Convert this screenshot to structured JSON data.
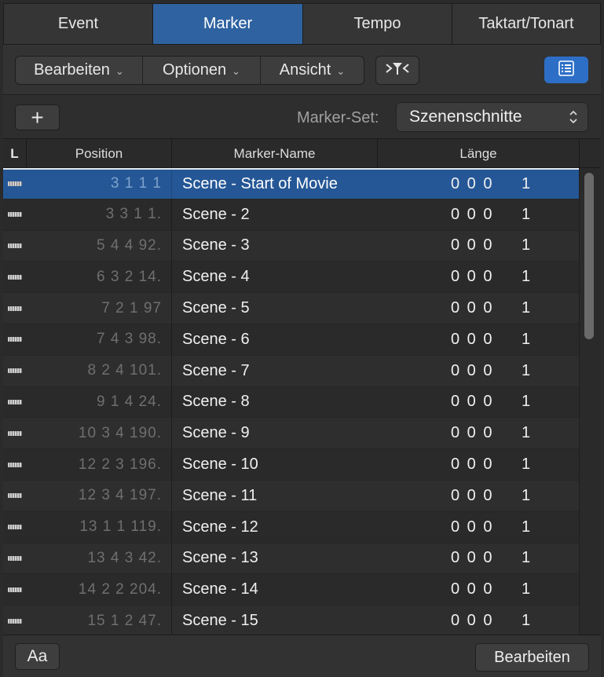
{
  "tabs": [
    {
      "label": "Event",
      "active": false
    },
    {
      "label": "Marker",
      "active": true
    },
    {
      "label": "Tempo",
      "active": false
    },
    {
      "label": "Taktart/Tonart",
      "active": false
    }
  ],
  "toolbar": {
    "menus": [
      "Bearbeiten",
      "Optionen",
      "Ansicht"
    ],
    "filter_icon": "midi-filter-icon",
    "list_icon": "list-view-icon"
  },
  "marker_set": {
    "add_label": "+",
    "label": "Marker-Set:",
    "value": "Szenenschnitte"
  },
  "columns": {
    "lock": "L",
    "position": "Position",
    "name": "Marker-Name",
    "length": "Länge"
  },
  "rows": [
    {
      "position": "3 1 1     1",
      "name": "Scene - Start of Movie",
      "length_bars": "0 0 0",
      "length_ticks": "1",
      "selected": true
    },
    {
      "position": "3 3 1     1.",
      "name": "Scene - 2",
      "length_bars": "0 0 0",
      "length_ticks": "1",
      "selected": false
    },
    {
      "position": "5 4 4   92.",
      "name": "Scene - 3",
      "length_bars": "0 0 0",
      "length_ticks": "1",
      "selected": false
    },
    {
      "position": "6 3 2   14.",
      "name": "Scene - 4",
      "length_bars": "0 0 0",
      "length_ticks": "1",
      "selected": false
    },
    {
      "position": "7 2 1   97",
      "name": "Scene - 5",
      "length_bars": "0 0 0",
      "length_ticks": "1",
      "selected": false
    },
    {
      "position": "7 4 3   98.",
      "name": "Scene - 6",
      "length_bars": "0 0 0",
      "length_ticks": "1",
      "selected": false
    },
    {
      "position": "8 2 4 101.",
      "name": "Scene - 7",
      "length_bars": "0 0 0",
      "length_ticks": "1",
      "selected": false
    },
    {
      "position": "9 1 4   24.",
      "name": "Scene - 8",
      "length_bars": "0 0 0",
      "length_ticks": "1",
      "selected": false
    },
    {
      "position": "10 3 4 190.",
      "name": "Scene - 9",
      "length_bars": "0 0 0",
      "length_ticks": "1",
      "selected": false
    },
    {
      "position": "12 2 3 196.",
      "name": "Scene - 10",
      "length_bars": "0 0 0",
      "length_ticks": "1",
      "selected": false
    },
    {
      "position": "12 3 4 197.",
      "name": "Scene - 11",
      "length_bars": "0 0 0",
      "length_ticks": "1",
      "selected": false
    },
    {
      "position": "13 1 1 119.",
      "name": "Scene - 12",
      "length_bars": "0 0 0",
      "length_ticks": "1",
      "selected": false
    },
    {
      "position": "13 4 3   42.",
      "name": "Scene - 13",
      "length_bars": "0 0 0",
      "length_ticks": "1",
      "selected": false
    },
    {
      "position": "14 2 2 204.",
      "name": "Scene - 14",
      "length_bars": "0 0 0",
      "length_ticks": "1",
      "selected": false
    },
    {
      "position": "15 1 2   47.",
      "name": "Scene - 15",
      "length_bars": "0 0 0",
      "length_ticks": "1",
      "selected": false
    }
  ],
  "footer": {
    "font_button": "Aa",
    "edit_button": "Bearbeiten"
  },
  "colors": {
    "accent": "#2f62a0",
    "selected_row": "#255796",
    "list_button": "#2d6fc7"
  }
}
